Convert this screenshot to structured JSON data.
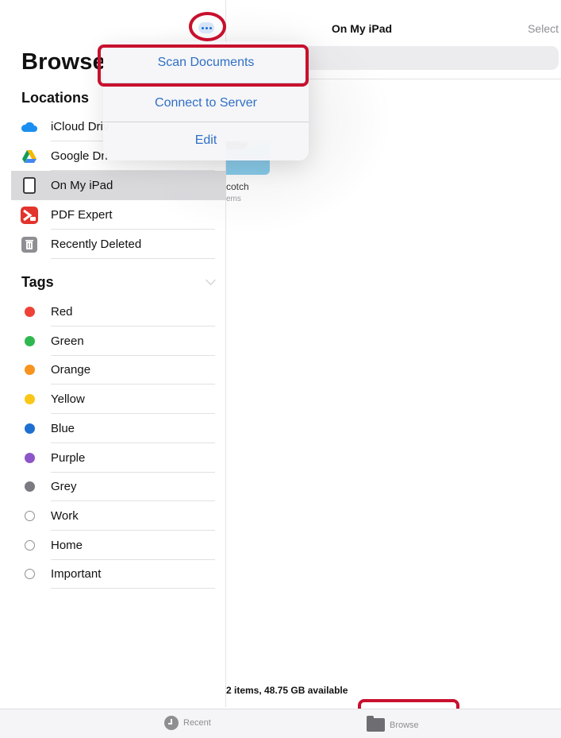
{
  "sidebar": {
    "title": "Browse",
    "locations": {
      "heading": "Locations",
      "items": [
        {
          "label": "iCloud Driv",
          "icon": "icloud-drive-icon"
        },
        {
          "label": "Google Dri",
          "icon": "google-drive-icon"
        },
        {
          "label": "On My iPad",
          "icon": "ipad-icon",
          "selected": true
        },
        {
          "label": "PDF Expert",
          "icon": "pdf-expert-icon"
        },
        {
          "label": "Recently Deleted",
          "icon": "trash-icon"
        }
      ]
    },
    "tags": {
      "heading": "Tags",
      "items": [
        {
          "label": "Red",
          "color": "#ef4136"
        },
        {
          "label": "Green",
          "color": "#2fb84f"
        },
        {
          "label": "Orange",
          "color": "#f7931e"
        },
        {
          "label": "Yellow",
          "color": "#fbc617"
        },
        {
          "label": "Blue",
          "color": "#1f6fd1"
        },
        {
          "label": "Purple",
          "color": "#8e55c8"
        },
        {
          "label": "Grey",
          "color": "#7a7a80"
        },
        {
          "label": "Work",
          "color": ""
        },
        {
          "label": "Home",
          "color": ""
        },
        {
          "label": "Important",
          "color": ""
        }
      ]
    }
  },
  "main": {
    "title": "On My iPad",
    "select_label": "Select",
    "folder": {
      "name": "cotch",
      "sub": "ems"
    },
    "status": "2 items, 48.75 GB available"
  },
  "menu": {
    "more_icon": "ellipsis-icon",
    "items": [
      "Scan Documents",
      "Connect to Server",
      "Edit"
    ]
  },
  "tabbar": {
    "recent": "Recent",
    "browse": "Browse"
  },
  "colors": {
    "accent": "#2f6fc4",
    "highlight": "#c8102e",
    "folder": "#6cc3ea"
  }
}
